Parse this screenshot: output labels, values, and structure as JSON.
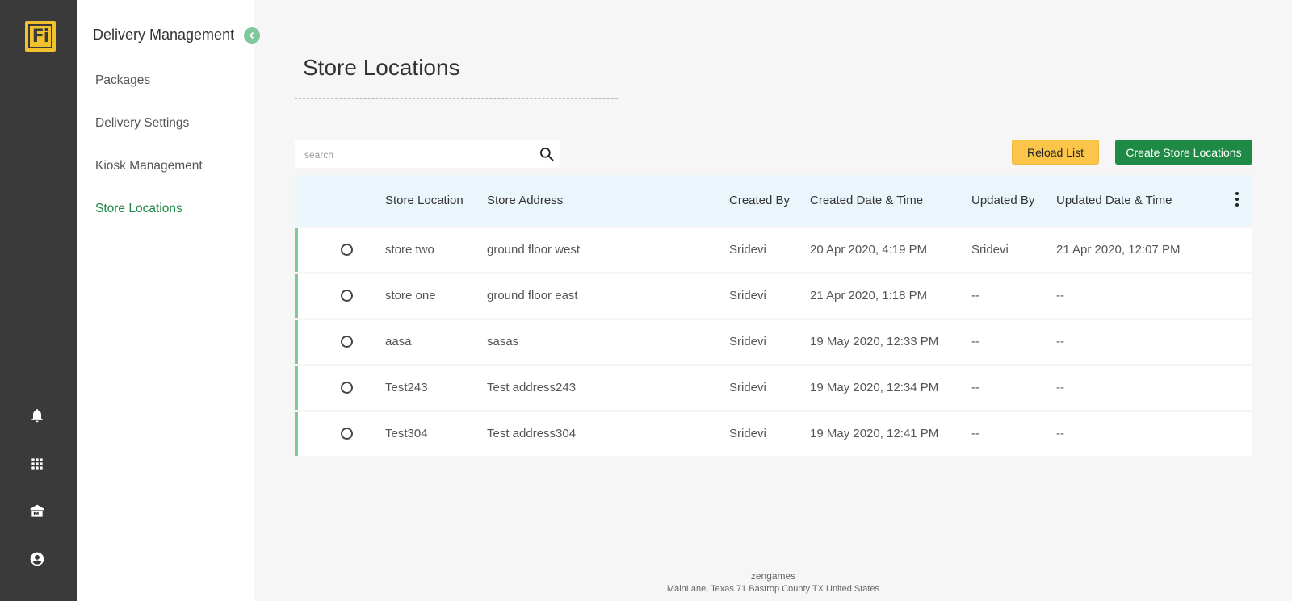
{
  "rail": {
    "logo_text": "Fi",
    "logo_color": "#f2c12e",
    "icons": [
      "bell-icon",
      "apps-grid-icon",
      "store-icon",
      "account-icon"
    ]
  },
  "subnav": {
    "title": "Delivery Management",
    "items": [
      {
        "label": "Packages",
        "active": false
      },
      {
        "label": "Delivery Settings",
        "active": false
      },
      {
        "label": "Kiosk Management",
        "active": false
      },
      {
        "label": "Store Locations",
        "active": true
      }
    ]
  },
  "main": {
    "title": "Store Locations",
    "search": {
      "placeholder": "search",
      "value": ""
    },
    "reload_label": "Reload List",
    "create_label": "Create Store Locations"
  },
  "table": {
    "columns": [
      "Store Location",
      "Store Address",
      "Created By",
      "Created Date & Time",
      "Updated By",
      "Updated Date & Time"
    ],
    "rows": [
      {
        "location": "store two",
        "address": "ground floor west",
        "created_by": "Sridevi",
        "created_at": "20 Apr 2020, 4:19 PM",
        "updated_by": "Sridevi",
        "updated_at": "21 Apr 2020, 12:07 PM"
      },
      {
        "location": "store one",
        "address": "ground floor east",
        "created_by": "Sridevi",
        "created_at": "21 Apr 2020, 1:18 PM",
        "updated_by": "--",
        "updated_at": "--"
      },
      {
        "location": "aasa",
        "address": "sasas",
        "created_by": "Sridevi",
        "created_at": "19 May 2020, 12:33 PM",
        "updated_by": "--",
        "updated_at": "--"
      },
      {
        "location": "Test243",
        "address": "Test address243",
        "created_by": "Sridevi",
        "created_at": "19 May 2020, 12:34 PM",
        "updated_by": "--",
        "updated_at": "--"
      },
      {
        "location": "Test304",
        "address": "Test address304",
        "created_by": "Sridevi",
        "created_at": "19 May 2020, 12:41 PM",
        "updated_by": "--",
        "updated_at": "--"
      }
    ]
  },
  "footer": {
    "company": "zengames",
    "address": "MainLane, Texas 71 Bastrop County TX United States"
  },
  "colors": {
    "accent_green": "#1e8a45",
    "reload_yellow": "#fbc54a",
    "row_marker": "#7fc89a",
    "header_bg": "#ebf5fc"
  }
}
